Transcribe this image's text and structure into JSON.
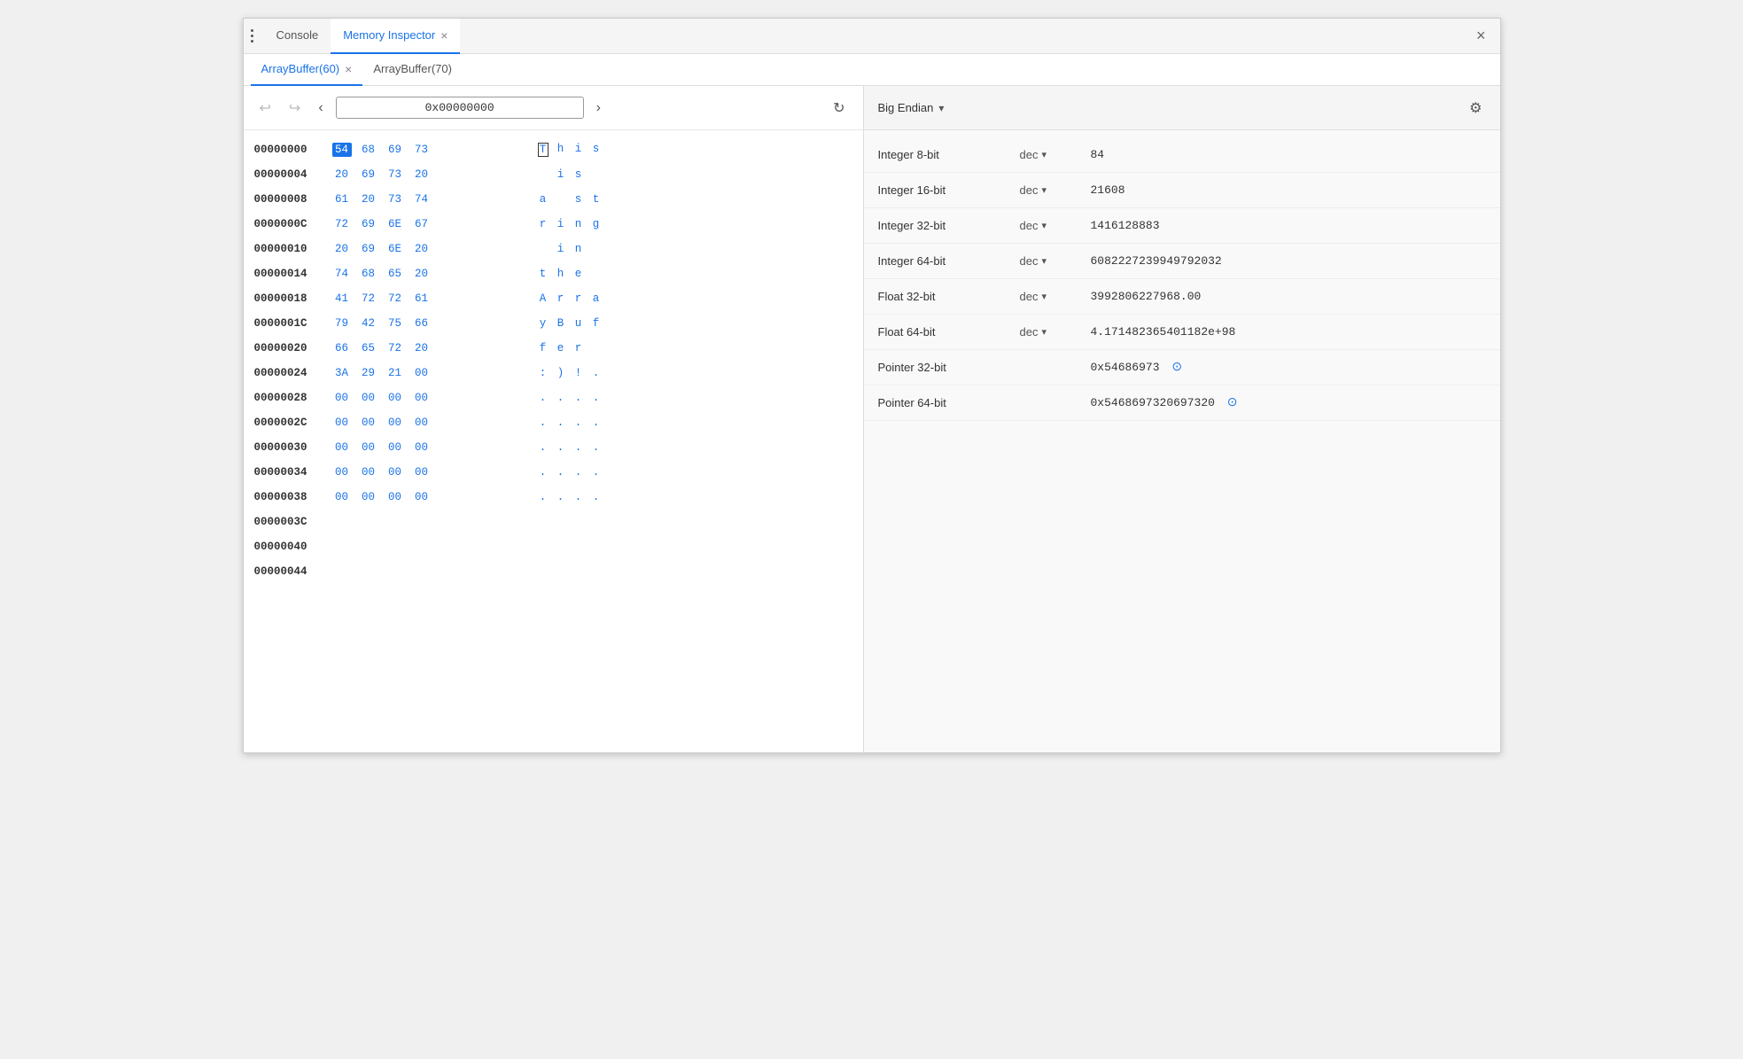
{
  "window": {
    "title": "Memory Inspector",
    "close_label": "×"
  },
  "top_tabs": [
    {
      "id": "console",
      "label": "Console",
      "active": false,
      "closeable": false
    },
    {
      "id": "memory-inspector",
      "label": "Memory Inspector",
      "active": true,
      "closeable": true
    }
  ],
  "sub_tabs": [
    {
      "id": "arraybuffer-60",
      "label": "ArrayBuffer(60)",
      "active": true,
      "closeable": true
    },
    {
      "id": "arraybuffer-70",
      "label": "ArrayBuffer(70)",
      "active": false,
      "closeable": false
    }
  ],
  "address_bar": {
    "back_disabled": true,
    "forward_disabled": true,
    "address": "0x00000000",
    "prev_label": "‹",
    "next_label": "›",
    "refresh_label": "↻"
  },
  "memory_rows": [
    {
      "addr": "00000000",
      "bytes": [
        "54",
        "68",
        "69",
        "73"
      ],
      "ascii": [
        "T",
        "h",
        "i",
        "s"
      ],
      "selected_byte": 0,
      "selected_ascii": 0
    },
    {
      "addr": "00000004",
      "bytes": [
        "20",
        "69",
        "73",
        "20"
      ],
      "ascii": [
        " ",
        "i",
        "s",
        " "
      ]
    },
    {
      "addr": "00000008",
      "bytes": [
        "61",
        "20",
        "73",
        "74"
      ],
      "ascii": [
        "a",
        " ",
        "s",
        "t"
      ]
    },
    {
      "addr": "0000000C",
      "bytes": [
        "72",
        "69",
        "6E",
        "67"
      ],
      "ascii": [
        "r",
        "i",
        "n",
        "g"
      ]
    },
    {
      "addr": "00000010",
      "bytes": [
        "20",
        "69",
        "6E",
        "20"
      ],
      "ascii": [
        " ",
        "i",
        "n",
        " "
      ]
    },
    {
      "addr": "00000014",
      "bytes": [
        "74",
        "68",
        "65",
        "20"
      ],
      "ascii": [
        "t",
        "h",
        "e",
        " "
      ]
    },
    {
      "addr": "00000018",
      "bytes": [
        "41",
        "72",
        "72",
        "61"
      ],
      "ascii": [
        "A",
        "r",
        "r",
        "a"
      ]
    },
    {
      "addr": "0000001C",
      "bytes": [
        "79",
        "42",
        "75",
        "66"
      ],
      "ascii": [
        "y",
        "B",
        "u",
        "f"
      ]
    },
    {
      "addr": "00000020",
      "bytes": [
        "66",
        "65",
        "72",
        "20"
      ],
      "ascii": [
        "f",
        "e",
        "r",
        " "
      ]
    },
    {
      "addr": "00000024",
      "bytes": [
        "3A",
        "29",
        "21",
        "00"
      ],
      "ascii": [
        ":",
        ")",
        "!",
        "."
      ]
    },
    {
      "addr": "00000028",
      "bytes": [
        "00",
        "00",
        "00",
        "00"
      ],
      "ascii": [
        ".",
        ".",
        ".",
        "."
      ]
    },
    {
      "addr": "0000002C",
      "bytes": [
        "00",
        "00",
        "00",
        "00"
      ],
      "ascii": [
        ".",
        ".",
        ".",
        "."
      ]
    },
    {
      "addr": "00000030",
      "bytes": [
        "00",
        "00",
        "00",
        "00"
      ],
      "ascii": [
        ".",
        ".",
        ".",
        "."
      ]
    },
    {
      "addr": "00000034",
      "bytes": [
        "00",
        "00",
        "00",
        "00"
      ],
      "ascii": [
        ".",
        ".",
        ".",
        "."
      ]
    },
    {
      "addr": "00000038",
      "bytes": [
        "00",
        "00",
        "00",
        "00"
      ],
      "ascii": [
        ".",
        ".",
        ".",
        "."
      ]
    },
    {
      "addr": "0000003C",
      "bytes": [],
      "ascii": []
    },
    {
      "addr": "00000040",
      "bytes": [],
      "ascii": []
    },
    {
      "addr": "00000044",
      "bytes": [],
      "ascii": []
    }
  ],
  "right_panel": {
    "endian": "Big Endian",
    "settings_label": "⚙",
    "data_types": [
      {
        "type": "Integer 8-bit",
        "format": "dec",
        "has_dropdown": true,
        "value": "84",
        "is_pointer": false
      },
      {
        "type": "Integer 16-bit",
        "format": "dec",
        "has_dropdown": true,
        "value": "21608",
        "is_pointer": false
      },
      {
        "type": "Integer 32-bit",
        "format": "dec",
        "has_dropdown": true,
        "value": "1416128883",
        "is_pointer": false
      },
      {
        "type": "Integer 64-bit",
        "format": "dec",
        "has_dropdown": true,
        "value": "6082227239949792032",
        "is_pointer": false
      },
      {
        "type": "Float 32-bit",
        "format": "dec",
        "has_dropdown": true,
        "value": "3992806227968.00",
        "is_pointer": false
      },
      {
        "type": "Float 64-bit",
        "format": "dec",
        "has_dropdown": true,
        "value": "4.171482365401182e+98",
        "is_pointer": false
      },
      {
        "type": "Pointer 32-bit",
        "format": "",
        "has_dropdown": false,
        "value": "0x54686973",
        "is_pointer": true
      },
      {
        "type": "Pointer 64-bit",
        "format": "",
        "has_dropdown": false,
        "value": "0x5468697320697320",
        "is_pointer": true
      }
    ]
  },
  "icons": {
    "menu_dots": "⋮",
    "close_tab": "×",
    "close_window": "×",
    "back": "↩",
    "forward": "↪",
    "refresh": "↻",
    "settings": "⚙",
    "dropdown": "▾",
    "pointer_arrow": "→"
  }
}
